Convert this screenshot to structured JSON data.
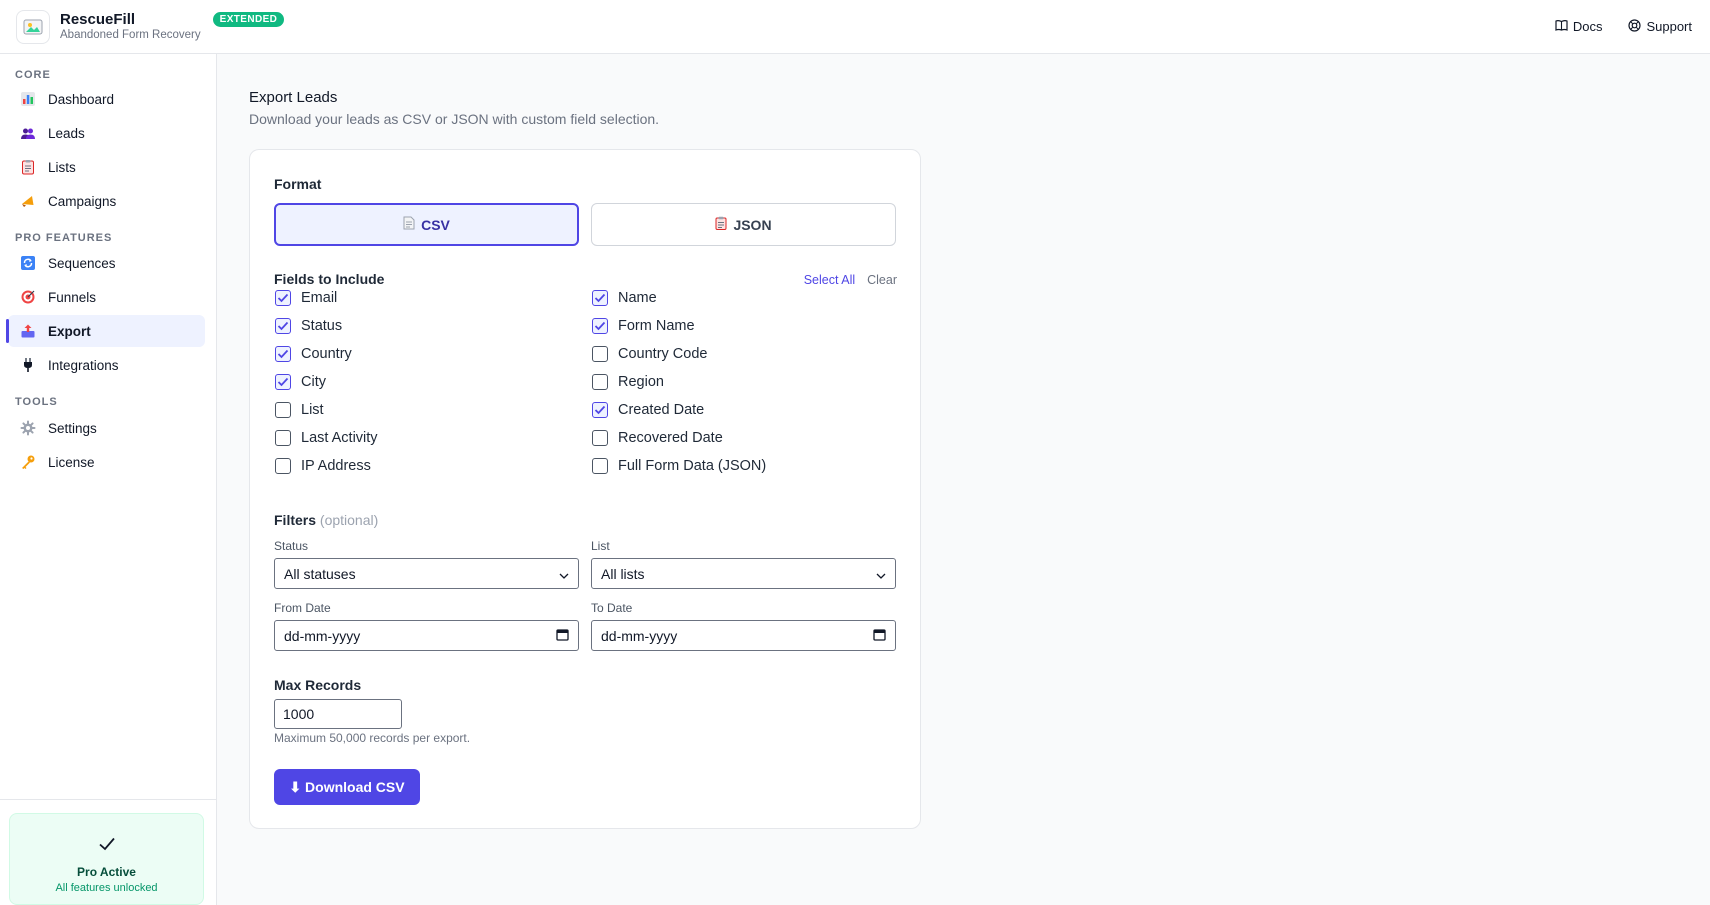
{
  "app": {
    "name": "RescueFill",
    "subtitle": "Abandoned Form Recovery",
    "badge": "EXTENDED",
    "logo_icon": "image-icon"
  },
  "header": {
    "docs_label": "Docs",
    "docs_icon": "book-icon",
    "support_label": "Support",
    "support_icon": "lifebuoy-icon"
  },
  "sidebar": {
    "sections": [
      {
        "label": "CORE"
      },
      {
        "label": "PRO FEATURES"
      },
      {
        "label": "TOOLS"
      }
    ],
    "items": [
      {
        "label": "Dashboard",
        "icon": "bar-chart-icon"
      },
      {
        "label": "Leads",
        "icon": "users-icon"
      },
      {
        "label": "Lists",
        "icon": "clipboard-icon"
      },
      {
        "label": "Campaigns",
        "icon": "megaphone-icon"
      },
      {
        "label": "Sequences",
        "icon": "refresh-icon"
      },
      {
        "label": "Funnels",
        "icon": "target-icon"
      },
      {
        "label": "Export",
        "icon": "outbox-icon",
        "active": true
      },
      {
        "label": "Integrations",
        "icon": "plug-icon"
      },
      {
        "label": "Settings",
        "icon": "gear-icon"
      },
      {
        "label": "License",
        "icon": "key-icon"
      }
    ],
    "pro_card": {
      "title": "Pro Active",
      "subtitle": "All features unlocked",
      "icon": "checkmark-icon"
    }
  },
  "page": {
    "title": "Export Leads",
    "subtitle": "Download your leads as CSV or JSON with custom field selection."
  },
  "export_form": {
    "format_label": "Format",
    "formats": [
      {
        "label": "CSV",
        "icon": "document-icon",
        "selected": true
      },
      {
        "label": "JSON",
        "icon": "clipboard-icon",
        "selected": false
      }
    ],
    "fields_label": "Fields to Include",
    "select_all_label": "Select All",
    "clear_label": "Clear",
    "fields": [
      {
        "label": "Email",
        "checked": true
      },
      {
        "label": "Name",
        "checked": true
      },
      {
        "label": "Status",
        "checked": true
      },
      {
        "label": "Form Name",
        "checked": true
      },
      {
        "label": "Country",
        "checked": true
      },
      {
        "label": "Country Code",
        "checked": false
      },
      {
        "label": "City",
        "checked": true
      },
      {
        "label": "Region",
        "checked": false
      },
      {
        "label": "List",
        "checked": false
      },
      {
        "label": "Created Date",
        "checked": true
      },
      {
        "label": "Last Activity",
        "checked": false
      },
      {
        "label": "Recovered Date",
        "checked": false
      },
      {
        "label": "IP Address",
        "checked": false
      },
      {
        "label": "Full Form Data (JSON)",
        "checked": false
      }
    ],
    "filters_label": "Filters",
    "filters_optional": "(optional)",
    "status_label": "Status",
    "status_value": "All statuses",
    "list_label": "List",
    "list_value": "All lists",
    "from_date_label": "From Date",
    "from_date_placeholder": "dd-mm-yyyy",
    "to_date_label": "To Date",
    "to_date_placeholder": "dd-mm-yyyy",
    "max_records_label": "Max Records",
    "max_records_value": "1000",
    "max_records_help": "Maximum 50,000 records per export.",
    "download_label": "⬇ Download CSV"
  },
  "colors": {
    "accent": "#4f46e5",
    "success": "#10b981"
  }
}
